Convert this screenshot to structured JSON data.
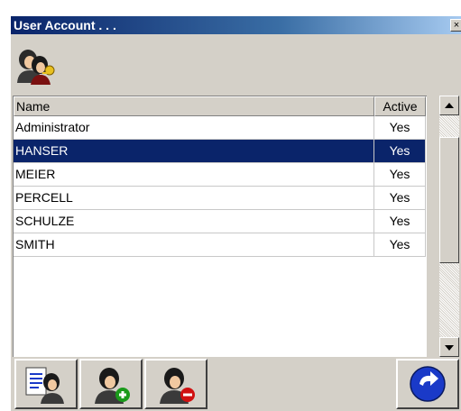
{
  "window": {
    "title": "User Account . . .",
    "close_glyph": "×"
  },
  "header": {
    "icon": "users-key-icon"
  },
  "grid": {
    "columns": [
      "Name",
      "Active"
    ],
    "rows": [
      {
        "name": "Administrator",
        "active": "Yes"
      },
      {
        "name": "HANSER",
        "active": "Yes",
        "selected": true
      },
      {
        "name": "MEIER",
        "active": "Yes"
      },
      {
        "name": "PERCELL",
        "active": "Yes"
      },
      {
        "name": "SCHULZE",
        "active": "Yes"
      },
      {
        "name": "SMITH",
        "active": "Yes"
      }
    ]
  },
  "toolbar": {
    "buttons": [
      {
        "icon": "user-properties-icon"
      },
      {
        "icon": "add-user-icon"
      },
      {
        "icon": "remove-user-icon"
      },
      {
        "icon": "back-arrow-icon"
      }
    ]
  },
  "colors": {
    "selection": "#0a246a",
    "title_bar": "#0a246a",
    "add": "#1a9a1a",
    "remove": "#d01010",
    "back": "#1a3ac8"
  }
}
